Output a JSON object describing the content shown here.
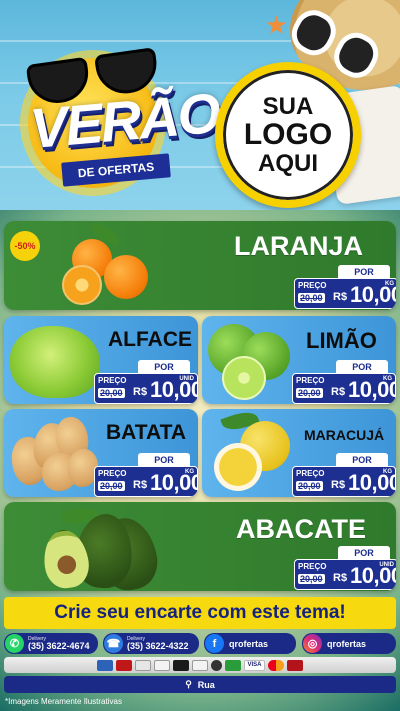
{
  "header": {
    "title": "VERÃO",
    "subtitle": "DE OFERTAS",
    "logo_placeholder": {
      "line1": "SUA",
      "line2": "LOGO",
      "line3": "AQUI"
    }
  },
  "products": [
    {
      "name": "LARANJA",
      "badge": "-50%",
      "preco_label": "PREÇO",
      "old_price": "20,00",
      "por_label": "POR",
      "currency": "R$",
      "price": "10,00",
      "unit": "KG"
    },
    {
      "name": "ALFACE",
      "preco_label": "PREÇO",
      "old_price": "20,00",
      "por_label": "POR",
      "currency": "R$",
      "price": "10,00",
      "unit": "UNID"
    },
    {
      "name": "LIMÃO",
      "preco_label": "PREÇO",
      "old_price": "20,00",
      "por_label": "POR",
      "currency": "R$",
      "price": "10,00",
      "unit": "KG"
    },
    {
      "name": "BATATA",
      "preco_label": "PREÇO",
      "old_price": "20,00",
      "por_label": "POR",
      "currency": "R$",
      "price": "10,00",
      "unit": "KG"
    },
    {
      "name": "MARACUJÁ",
      "preco_label": "PREÇO",
      "old_price": "20,00",
      "por_label": "POR",
      "currency": "R$",
      "price": "10,00",
      "unit": "KG"
    },
    {
      "name": "ABACATE",
      "preco_label": "PREÇO",
      "old_price": "20,00",
      "por_label": "POR",
      "currency": "R$",
      "price": "10,00",
      "unit": "UNID"
    }
  ],
  "cta": "Crie seu encarte com este tema!",
  "contacts": {
    "whatsapp": {
      "label": "Delivery",
      "phone": "(35) 3622-4674",
      "icon": "whatsapp-icon",
      "color": "#25d366"
    },
    "phone": {
      "label": "Delivery",
      "phone": "(35) 3622-4322",
      "icon": "phone-icon",
      "color": "#2f7be0"
    },
    "facebook": {
      "handle": "qrofertas",
      "icon": "facebook-icon",
      "color": "#1877f2"
    },
    "instagram": {
      "handle": "qrofertas",
      "icon": "instagram-icon",
      "color": "#d6249f"
    }
  },
  "payments": [
    "card",
    "card",
    "card",
    "card",
    "card",
    "card",
    "card",
    "card",
    "VISA",
    "mastercard",
    "hipercard"
  ],
  "address": {
    "icon": "location-pin-icon",
    "text": "Rua"
  },
  "disclaimer": "*Imagens Meramente Ilustrativas",
  "colors": {
    "green_card": "#3d8c36",
    "blue_card": "#4aa3e2",
    "price_blue": "#1e2f92",
    "cta_yellow": "#f6d90f"
  }
}
